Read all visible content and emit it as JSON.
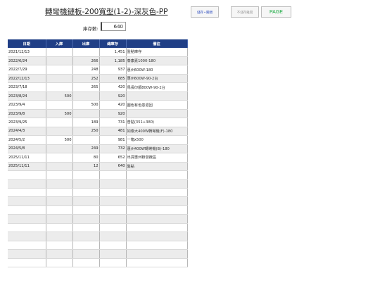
{
  "header": {
    "title": "轉彎機鏈板-200寬型(1-2)-深灰色-PP",
    "stock_label": "庫存數:",
    "stock_value": "640"
  },
  "buttons": {
    "save_label": "儲存 • 關閉",
    "nosave_label": "不儲存離開",
    "page_label": "PAGE"
  },
  "table": {
    "columns": [
      "日期",
      "入庫",
      "出庫",
      "總庫存",
      "備註"
    ],
    "rows": [
      [
        "2021/12/13",
        "",
        "",
        "1,451",
        "盤點庫存"
      ],
      [
        "2022/6/24",
        "",
        "266",
        "1,185",
        "泰康素1000-180"
      ],
      [
        "2022/7/29",
        "",
        "248",
        "937",
        "惠州600W-180"
      ],
      [
        "2022/12/13",
        "",
        "252",
        "685",
        "惠州600W-90-2台"
      ],
      [
        "2023/7/18",
        "",
        "265",
        "420",
        "馬長印順800W-90-2台"
      ],
      [
        "2023/8/24",
        "500",
        "",
        "920",
        ""
      ],
      [
        "2023/9/4",
        "",
        "500",
        "420",
        "圖色有色患退回"
      ],
      [
        "2023/9/8",
        "500",
        "",
        "920",
        ""
      ],
      [
        "2023/9/25",
        "",
        "189",
        "731",
        "普點(351+380)"
      ],
      [
        "2024/4/3",
        "",
        "250",
        "481",
        "如泰大400W轉彎機(F)-180"
      ],
      [
        "2024/5/2",
        "500",
        "",
        "981",
        "一箱x500"
      ],
      [
        "2024/5/8",
        "",
        "249",
        "732",
        "惠州400W轉彎機(B)-180"
      ],
      [
        "2025/11/11",
        "",
        "80",
        "652",
        "出貨惠州聯發廠區"
      ],
      [
        "2025/11/11",
        "",
        "12",
        "640",
        "盤點"
      ]
    ],
    "empty_rows": 11
  }
}
